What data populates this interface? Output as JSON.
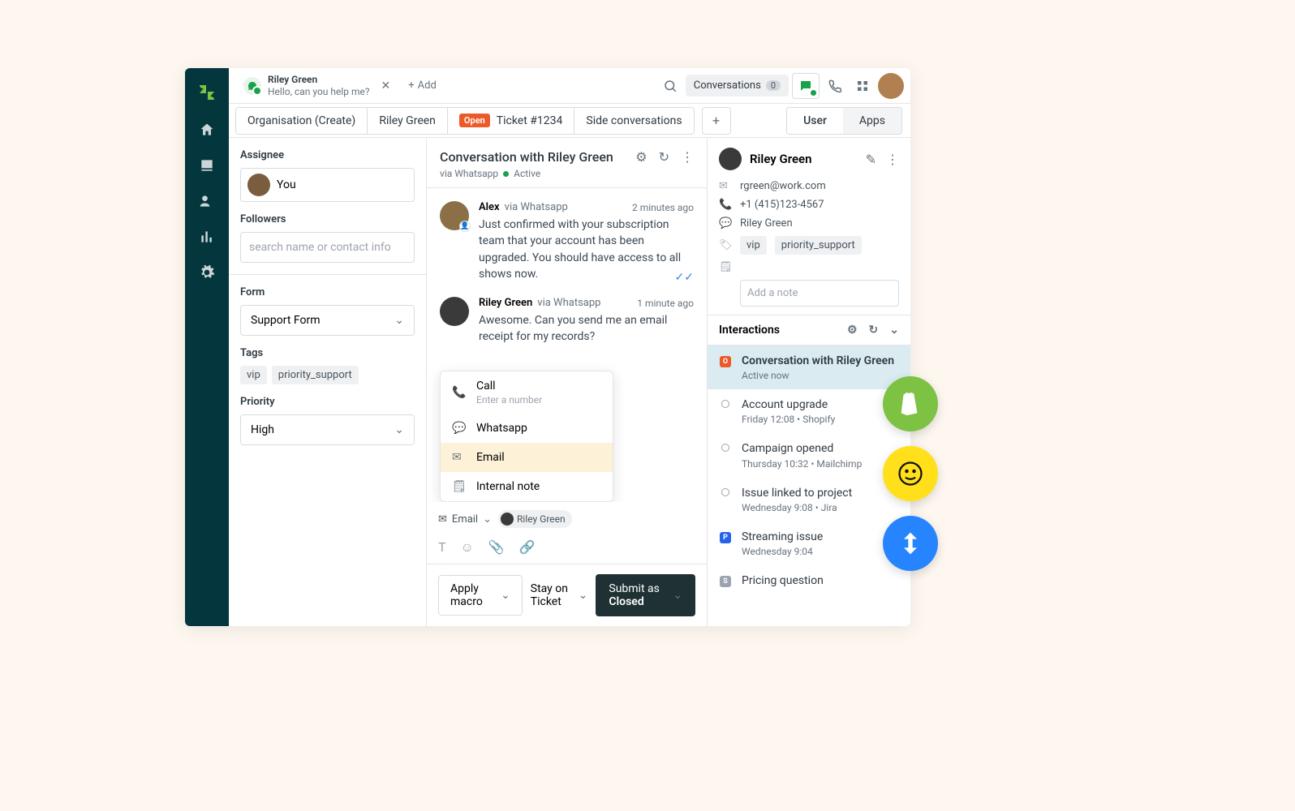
{
  "activeTab": {
    "name": "Riley Green",
    "preview": "Hello, can you help me?"
  },
  "topBar": {
    "addLabel": "Add",
    "convLabel": "Conversations",
    "convCount": "0"
  },
  "ticketTabs": {
    "org": "Organisation (Create)",
    "user": "Riley Green",
    "ticketBadge": "Open",
    "ticket": "Ticket #1234",
    "side": "Side conversations"
  },
  "segTabs": {
    "user": "User",
    "apps": "Apps"
  },
  "leftPane": {
    "assigneeLabel": "Assignee",
    "assigneeValue": "You",
    "followersLabel": "Followers",
    "followersPlaceholder": "search name or contact info",
    "formLabel": "Form",
    "formValue": "Support Form",
    "tagsLabel": "Tags",
    "tags": [
      "vip",
      "priority_support"
    ],
    "priorityLabel": "Priority",
    "priorityValue": "High"
  },
  "conv": {
    "title": "Conversation with Riley Green",
    "viaLabel": "via Whatsapp",
    "activeLabel": "Active",
    "messages": [
      {
        "author": "Alex",
        "via": "via Whatsapp",
        "time": "2 minutes ago",
        "text": "Just confirmed with your subscription team that your account has been upgraded. You should have access to all shows now.",
        "read": true
      },
      {
        "author": "Riley Green",
        "via": "via Whatsapp",
        "time": "1 minute ago",
        "text": "Awesome. Can you send me an email receipt for my records?",
        "read": false
      }
    ]
  },
  "channelMenu": {
    "call": "Call",
    "callSub": "Enter a number",
    "whatsapp": "Whatsapp",
    "email": "Email",
    "note": "Internal note"
  },
  "compose": {
    "channel": "Email",
    "toName": "Riley Green"
  },
  "footer": {
    "macro": "Apply macro",
    "stay": "Stay on Ticket",
    "submitPrefix": "Submit as ",
    "submitStatus": "Closed"
  },
  "rightPane": {
    "name": "Riley Green",
    "email": "rgreen@work.com",
    "phone": "+1 (415)123-4567",
    "whatsappName": "Riley Green",
    "tags": [
      "vip",
      "priority_support"
    ],
    "notePlaceholder": "Add a note",
    "interLabel": "Interactions",
    "timeline": [
      {
        "kind": "open",
        "title": "Conversation with Riley Green",
        "sub": "Active now"
      },
      {
        "kind": "circle",
        "title": "Account upgrade",
        "sub": "Friday 12:08 • Shopify"
      },
      {
        "kind": "circle",
        "title": "Campaign opened",
        "sub": "Thursday 10:32 • Mailchimp"
      },
      {
        "kind": "circle",
        "title": "Issue linked to project",
        "sub": "Wednesday 9:08 • Jira"
      },
      {
        "kind": "problem",
        "title": "Streaming issue",
        "sub": "Wednesday 9:04"
      },
      {
        "kind": "solved",
        "title": "Pricing question",
        "sub": ""
      }
    ]
  }
}
